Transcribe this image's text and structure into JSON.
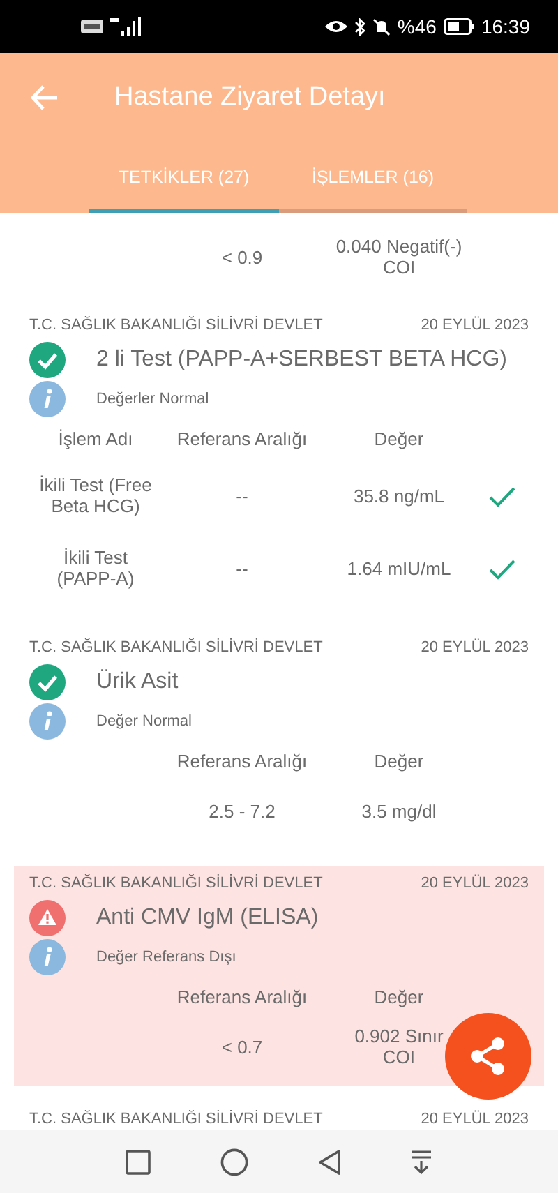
{
  "status_bar": {
    "battery": "%46",
    "time": "16:39"
  },
  "header": {
    "title": "Hastane Ziyaret Detayı"
  },
  "tabs": [
    {
      "label": "TETKİKLER (27)",
      "selected": true
    },
    {
      "label": "İŞLEMLER (16)",
      "selected": false
    }
  ],
  "top_row": {
    "reference": "< 0.9",
    "value": "0.040 Negatif(-) COI"
  },
  "results": [
    {
      "hospital": "T.C. SAĞLIK BAKANLIĞI SİLİVRİ DEVLET",
      "date": "20 EYLÜL 2023",
      "kind": "normal",
      "test": "2 li Test (PAPP-A+SERBEST BETA HCG)",
      "note": "Değerler Normal",
      "columns": [
        "İşlem Adı",
        "Referans Aralığı",
        "Değer"
      ],
      "rows": [
        {
          "name": "İkili Test (Free Beta HCG)",
          "reference": "--",
          "value": "35.8 ng/mL",
          "ok": true
        },
        {
          "name": "İkili Test (PAPP-A)",
          "reference": "--",
          "value": "1.64 mIU/mL",
          "ok": true
        }
      ]
    },
    {
      "hospital": "T.C. SAĞLIK BAKANLIĞI SİLİVRİ DEVLET",
      "date": "20 EYLÜL 2023",
      "kind": "normal",
      "test": "Ürik Asit",
      "note": "Değer Normal",
      "columns": [
        "Referans Aralığı",
        "Değer"
      ],
      "rows": [
        {
          "reference": "2.5 - 7.2",
          "value": "3.5 mg/dl"
        }
      ]
    },
    {
      "hospital": "T.C. SAĞLIK BAKANLIĞI SİLİVRİ DEVLET",
      "date": "20 EYLÜL 2023",
      "kind": "abnormal",
      "test": "Anti CMV IgM (ELISA)",
      "note": "Değer Referans Dışı",
      "columns": [
        "Referans Aralığı",
        "Değer"
      ],
      "rows": [
        {
          "reference": "< 0.7",
          "value": "0.902 Sınır\nCOI"
        }
      ]
    },
    {
      "hospital": "T.C. SAĞLIK BAKANLIĞI SİLİVRİ DEVLET",
      "date": "20 EYLÜL 2023"
    }
  ]
}
